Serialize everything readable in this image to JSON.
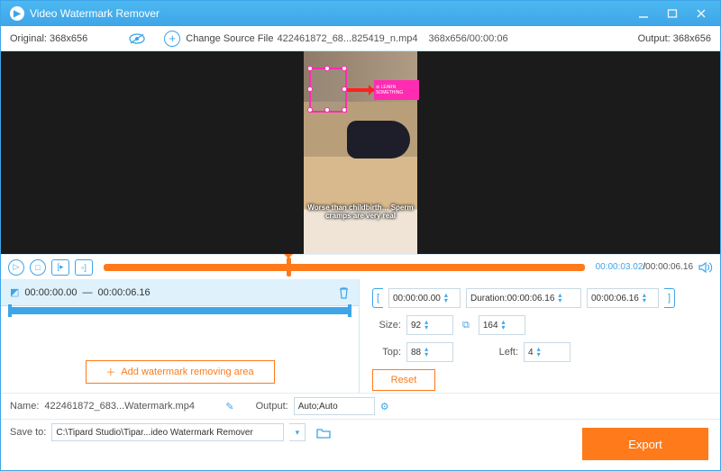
{
  "titlebar": {
    "title": "Video Watermark Remover"
  },
  "infobar": {
    "original_label": "Original:",
    "original_value": "368x656",
    "change_source": "Change Source File",
    "filename": "422461872_68...825419_n.mp4",
    "meta": "368x656/00:00:06",
    "output_label": "Output:",
    "output_value": "368x656"
  },
  "preview": {
    "caption": "Worse than childbirth… Sperm cramps are very real",
    "badge_text": "⊘ LEARN SOMETHING"
  },
  "transport": {
    "current": "00:00:03.02",
    "total": "00:00:06.16"
  },
  "segment": {
    "start": "00:00:00.00",
    "end": "00:00:06.16",
    "separator": "—"
  },
  "add_area": "Add watermark removing area",
  "timebox": {
    "start": "00:00:00.00",
    "duration_label": "Duration:",
    "duration_value": "00:00:06.16",
    "end": "00:00:06.16"
  },
  "size": {
    "label": "Size:",
    "w": "92",
    "h": "164"
  },
  "pos": {
    "top_label": "Top:",
    "top": "88",
    "left_label": "Left:",
    "left": "4"
  },
  "reset": "Reset",
  "bottom": {
    "name_label": "Name:",
    "name_value": "422461872_683...Watermark.mp4",
    "output_label": "Output:",
    "output_value": "Auto;Auto",
    "saveto_label": "Save to:",
    "saveto_value": "C:\\Tipard Studio\\Tipar...ideo Watermark Remover"
  },
  "export": "Export"
}
